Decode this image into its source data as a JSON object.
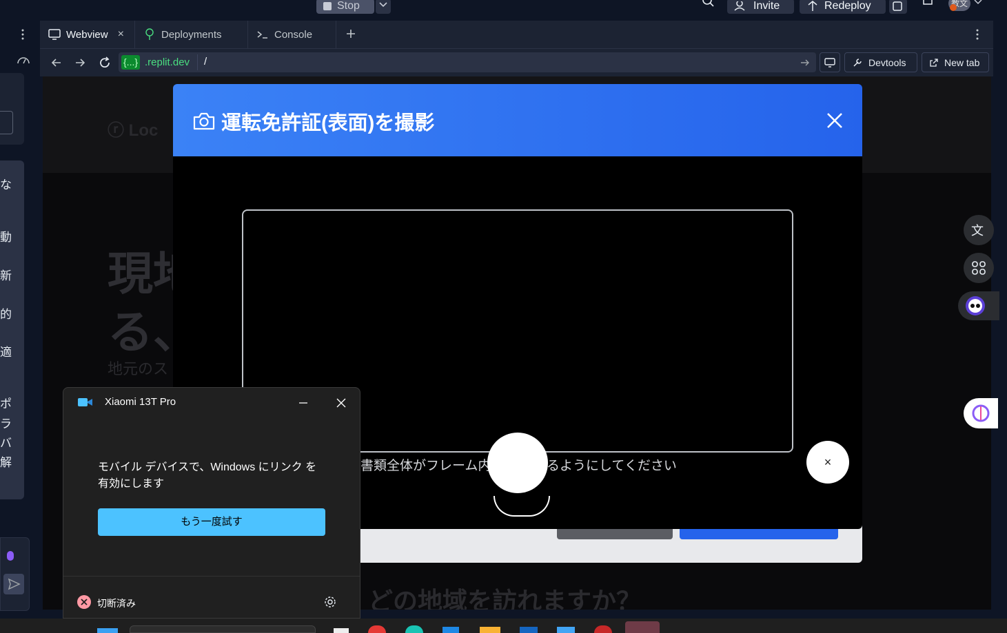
{
  "topbar": {
    "stop_label": "Stop",
    "invite_label": "Invite",
    "redeploy_label": "Redeploy",
    "avatar_text": "教文"
  },
  "left_sidebar": {
    "visible_chars": [
      "な",
      "動",
      "新",
      "的",
      "適",
      "ポ",
      "ラ",
      "バ",
      "解"
    ]
  },
  "tabs": [
    {
      "label": "Webview",
      "icon": "monitor-icon",
      "active": true
    },
    {
      "label": "Deployments",
      "icon": "deploy-icon",
      "active": false
    },
    {
      "label": "Console",
      "icon": "terminal-icon",
      "active": false
    }
  ],
  "urlbar": {
    "domain_badge": "{...}",
    "domain_suffix": ".replit.dev",
    "path": "/",
    "devtools_label": "Devtools",
    "newtab_label": "New tab"
  },
  "webpage": {
    "logo_text": "ⓡ Loc",
    "headline_line1": "現地",
    "headline_line2": "る、",
    "sub_text": "地元のス",
    "question_text": "どの地域を訪れますか？"
  },
  "camera_modal": {
    "title": "運転免許証(表面)を撮影",
    "hint_left": "書類全体がフレーム内",
    "hint_right": "るようにしてください",
    "close_button_symbol": "×"
  },
  "phone_link_window": {
    "title": "Xiaomi 13T Pro",
    "message": "モバイル デバイスで、Windows にリンク を有効にします",
    "retry_label": "もう一度試す",
    "status_label": "切断済み"
  },
  "colors": {
    "accent_blue": "#3b82f6",
    "replit_bg": "#0e1525",
    "retry_button": "#4cc2ff",
    "error_red": "#ff99a4"
  }
}
